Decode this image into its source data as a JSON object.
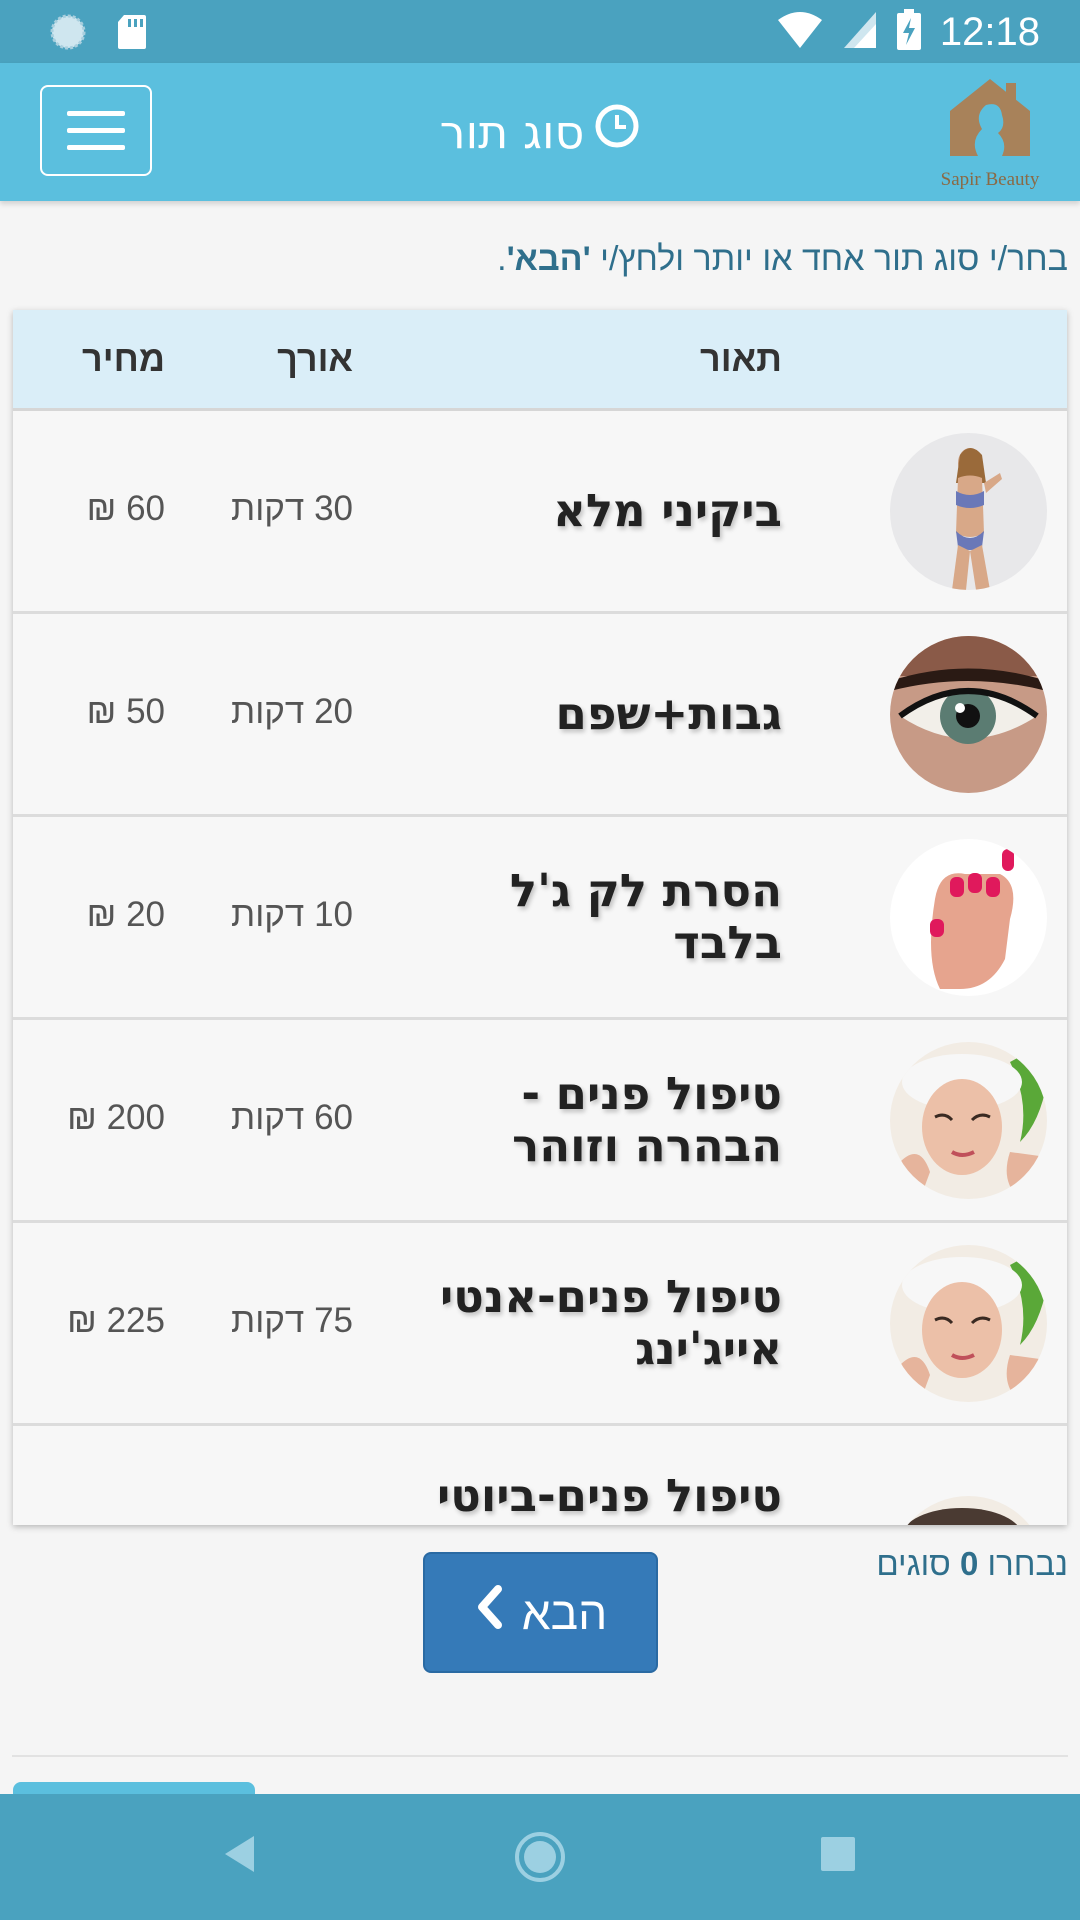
{
  "status_bar": {
    "time": "12:18"
  },
  "app_bar": {
    "title": "סוג תור",
    "logo_text": "Sapir Beauty"
  },
  "instruction": {
    "text": "בחר/י סוג תור אחד או יותר ולחץ/י ",
    "emphasis": "'הבא'",
    "end": "."
  },
  "table": {
    "headers": {
      "description": "תאור",
      "length": "אורך",
      "price": "מחיר"
    },
    "rows": [
      {
        "title": "ביקיני מלא",
        "length": "30 דקות",
        "price": "60 ₪",
        "image": "bikini-model"
      },
      {
        "title": "גבות+שפם",
        "length": "20 דקות",
        "price": "50 ₪",
        "image": "eye-closeup"
      },
      {
        "title": "הסרת לק ג'ל בלבד",
        "length": "10 דקות",
        "price": "20 ₪",
        "image": "hand-nails"
      },
      {
        "title": "טיפול פנים - הבהרה וזוהר",
        "length": "60 דקות",
        "price": "200 ₪",
        "image": "facial-treatment"
      },
      {
        "title": "טיפול פנים-אנטי אייג'ינג",
        "length": "75 דקות",
        "price": "225 ₪",
        "image": "facial-treatment"
      },
      {
        "title": "טיפול פנים-ביוטי",
        "length": "",
        "price": "",
        "image": "facial-treatment"
      }
    ]
  },
  "footer": {
    "selected_prefix": "נבחרו ",
    "selected_count": "0",
    "selected_suffix": " סוגים",
    "next_label": "הבא"
  },
  "colors": {
    "app_bar": "#5bbfde",
    "status_bar": "#4aa2bf",
    "button": "#357ab8",
    "header_row": "#daeef8"
  }
}
